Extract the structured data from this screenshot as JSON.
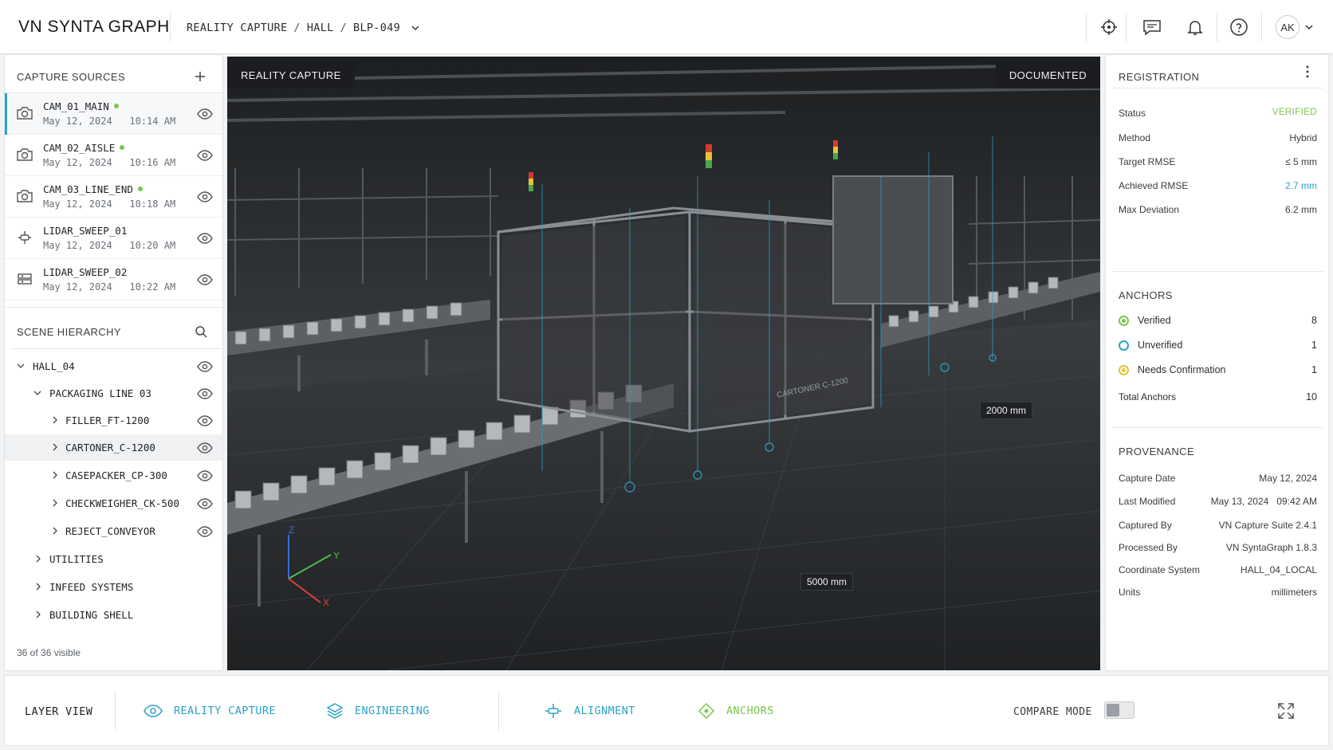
{
  "header": {
    "brand": "VN SYNTA GRAPH",
    "breadcrumb": [
      "REALITY CAPTURE",
      "HALL",
      "BLP-049"
    ],
    "avatar": "AK",
    "icons": [
      "crosshair-icon",
      "comment-icon",
      "bell-icon",
      "help-icon"
    ]
  },
  "capture_sources": {
    "title": "CAPTURE SOURCES",
    "items": [
      {
        "name": "CAM_01_MAIN",
        "date": "May 12, 2024   10:14 AM",
        "online": true,
        "icon": "camera-icon"
      },
      {
        "name": "CAM_02_AISLE",
        "date": "May 12, 2024   10:16 AM",
        "online": true,
        "icon": "camera-icon"
      },
      {
        "name": "CAM_03_LINE_END",
        "date": "May 12, 2024   10:18 AM",
        "online": true,
        "icon": "camera-icon"
      },
      {
        "name": "LIDAR_SWEEP_01",
        "date": "May 12, 2024   10:20 AM",
        "online": false,
        "icon": "lidar-icon"
      },
      {
        "name": "LIDAR_SWEEP_02",
        "date": "May 12, 2024   10:22 AM",
        "online": false,
        "icon": "scanner-icon"
      }
    ]
  },
  "scene_hierarchy": {
    "title": "SCENE HIERARCHY",
    "items": [
      {
        "label": "HALL_04"
      },
      {
        "label": "PACKAGING LINE 03"
      },
      {
        "label": "FILLER_FT-1200"
      },
      {
        "label": "CARTONER_C-1200"
      },
      {
        "label": "CASEPACKER_CP-300"
      },
      {
        "label": "CHECKWEIGHER_CK-500"
      },
      {
        "label": "REJECT_CONVEYOR"
      },
      {
        "label": "UTILITIES"
      },
      {
        "label": "INFEED SYSTEMS"
      },
      {
        "label": "BUILDING SHELL"
      }
    ],
    "footer": "36 of 36 visible"
  },
  "viewport": {
    "tag_left": "REALITY CAPTURE",
    "tag_right": "DOCUMENTED",
    "dim_1": "2000 mm",
    "dim_2": "5000 mm",
    "axes": {
      "x": "X",
      "y": "Y",
      "z": "Z"
    },
    "machine_label": "CARTONER C-1200"
  },
  "registration": {
    "title": "REGISTRATION",
    "rows": [
      {
        "label": "Status",
        "value": "VERIFIED"
      },
      {
        "label": "Method",
        "value": "Hybrid"
      },
      {
        "label": "Target RMSE",
        "value": "≤ 5 mm"
      },
      {
        "label": "Achieved RMSE",
        "value": "2.7 mm"
      },
      {
        "label": "Max Deviation",
        "value": "6.2 mm"
      }
    ],
    "colors": {
      "verified": "#7bc74a",
      "accent": "#2aa3c9",
      "warning": "#e3c43a"
    }
  },
  "anchors": {
    "title": "ANCHORS",
    "rows": [
      {
        "label": "Verified",
        "value": "8"
      },
      {
        "label": "Unverified",
        "value": "1"
      },
      {
        "label": "Needs Confirmation",
        "value": "1"
      }
    ],
    "total_label": "Total Anchors",
    "total_value": "10"
  },
  "provenance": {
    "title": "PROVENANCE",
    "rows": [
      {
        "label": "Capture Date",
        "value": "May 12, 2024"
      },
      {
        "label": "Last Modified",
        "value": "May 13, 2024   09:42 AM"
      },
      {
        "label": "Captured By",
        "value": "VN Capture Suite 2.4.1"
      },
      {
        "label": "Processed By",
        "value": "VN SyntaGraph 1.8.3"
      },
      {
        "label": "Coordinate System",
        "value": "HALL_04_LOCAL"
      },
      {
        "label": "Units",
        "value": "millimeters"
      }
    ]
  },
  "bottom_bar": {
    "title": "LAYER VIEW",
    "layers": [
      {
        "label": "REALITY CAPTURE",
        "icon": "eye-icon"
      },
      {
        "label": "ENGINEERING",
        "icon": "layers-icon"
      },
      {
        "label": "ALIGNMENT",
        "icon": "alignment-icon"
      },
      {
        "label": "ANCHORS",
        "icon": "anchor-diamond-icon"
      }
    ],
    "compare_label": "COMPARE MODE"
  }
}
